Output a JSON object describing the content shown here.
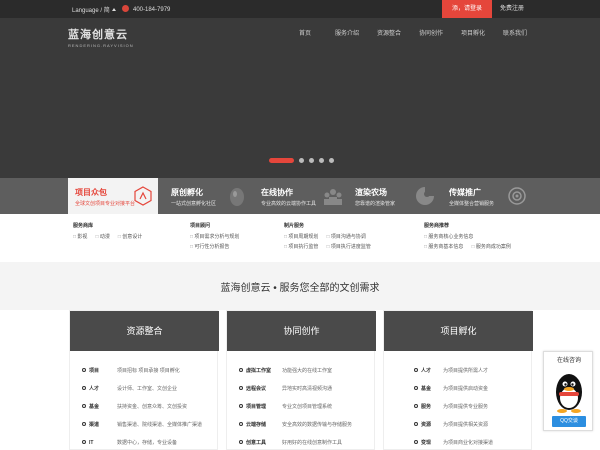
{
  "topbar": {
    "language": "Language / 简",
    "phone": "400-184-7979",
    "login": "添，请登录",
    "register": "免费注册"
  },
  "logo": {
    "main": "蓝海创意云",
    "sub": "RENDERING.RAYVISION"
  },
  "nav": [
    "首页",
    "服务介绍",
    "资源整合",
    "协同创作",
    "项目孵化",
    "联系我们"
  ],
  "services": [
    {
      "title": "项目众包",
      "subtitle": "全球文创项目专业对接平台"
    },
    {
      "title": "原创孵化",
      "subtitle": "一站式创意孵化社区"
    },
    {
      "title": "在线协作",
      "subtitle": "专业高效的云端协作工具"
    },
    {
      "title": "渲染农场",
      "subtitle": "您靠谱的渲染管家"
    },
    {
      "title": "传媒推广",
      "subtitle": "全媒体整合营销服务"
    }
  ],
  "subpanels": [
    {
      "heading": "服务商库",
      "rows": [
        [
          "影视",
          "动漫",
          "创意设计"
        ]
      ]
    },
    {
      "heading": "项目顾问",
      "rows": [
        [
          "项目需求分析与规划"
        ],
        [
          "可行性分析报告"
        ]
      ]
    },
    {
      "heading": "制片服务",
      "rows": [
        [
          "项目周期规划",
          "项目沟通与协调"
        ],
        [
          "项目执行监管",
          "项目执行进度监管"
        ]
      ]
    },
    {
      "heading": "服务商推荐",
      "rows": [
        [
          "服务商核心业务信息"
        ],
        [
          "服务商基本信息",
          "服务商成功案例"
        ]
      ]
    }
  ],
  "slogan": "蓝海创意云 • 服务您全部的文创需求",
  "cards": [
    {
      "title": "资源整合",
      "items": [
        {
          "k": "项目",
          "v": "项目招标 项目承接 项目孵化"
        },
        {
          "k": "人才",
          "v": "设计师、工作室、文创企业"
        },
        {
          "k": "基金",
          "v": "扶持资金、创意众筹、文创投资"
        },
        {
          "k": "渠道",
          "v": "销售渠道、院线渠道、全媒体推广渠道"
        },
        {
          "k": "IT",
          "v": "数据中心，存储，专业设备"
        }
      ]
    },
    {
      "title": "协同创作",
      "items": [
        {
          "k": "虚拟工作室",
          "v": "功能强大的在线工作室"
        },
        {
          "k": "远程会议",
          "v": "异地实时高清视频沟通"
        },
        {
          "k": "项目管理",
          "v": "专业文创项目管理系统"
        },
        {
          "k": "云端存储",
          "v": "安全高效的数据传输与存储服务"
        },
        {
          "k": "创意工具",
          "v": "好用好的在线创意制作工具"
        }
      ]
    },
    {
      "title": "项目孵化",
      "items": [
        {
          "k": "人才",
          "v": "为项目提供所需人才"
        },
        {
          "k": "基金",
          "v": "为项目提供启动资金"
        },
        {
          "k": "服务",
          "v": "为项目提供专业服务"
        },
        {
          "k": "资源",
          "v": "为项目提供相关资源"
        },
        {
          "k": "变现",
          "v": "为项目商业化对接渠道"
        }
      ]
    }
  ],
  "consult": {
    "title": "在线咨询",
    "button": "QQ交谈"
  },
  "colors": {
    "accent": "#e5463b",
    "qq": "#2c8ee0"
  }
}
